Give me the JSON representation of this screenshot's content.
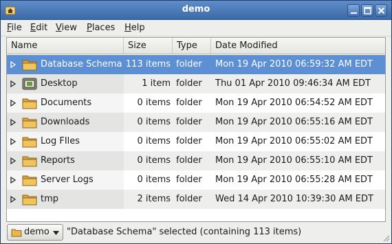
{
  "window": {
    "title": "demo",
    "icons": {
      "app": "home-folder-icon",
      "minimize": "minimize-icon",
      "maximize": "maximize-icon",
      "close": "close-icon"
    }
  },
  "menubar": {
    "items": [
      {
        "label": "File",
        "accel": "F",
        "rest": "ile"
      },
      {
        "label": "Edit",
        "accel": "E",
        "rest": "dit"
      },
      {
        "label": "View",
        "accel": "V",
        "rest": "iew"
      },
      {
        "label": "Places",
        "accel": "P",
        "rest": "laces"
      },
      {
        "label": "Help",
        "accel": "H",
        "rest": "elp"
      }
    ]
  },
  "columns": {
    "name": "Name",
    "size": "Size",
    "type": "Type",
    "date": "Date Modified"
  },
  "files": [
    {
      "name": "Database Schema",
      "size": "113 items",
      "type": "folder",
      "date": "Mon 19 Apr 2010 06:59:32 AM EDT",
      "icon": "folder-icon",
      "selected": true
    },
    {
      "name": "Desktop",
      "size": "1 item",
      "type": "folder",
      "date": "Thu 01 Apr 2010 09:46:34 AM EDT",
      "icon": "desktop-folder-icon",
      "selected": false
    },
    {
      "name": "Documents",
      "size": "0 items",
      "type": "folder",
      "date": "Mon 19 Apr 2010 06:54:52 AM EDT",
      "icon": "folder-icon",
      "selected": false
    },
    {
      "name": "Downloads",
      "size": "0 items",
      "type": "folder",
      "date": "Mon 19 Apr 2010 06:55:16 AM EDT",
      "icon": "folder-icon",
      "selected": false
    },
    {
      "name": "Log FIles",
      "size": "0 items",
      "type": "folder",
      "date": "Mon 19 Apr 2010 06:55:02 AM EDT",
      "icon": "folder-icon",
      "selected": false
    },
    {
      "name": "Reports",
      "size": "0 items",
      "type": "folder",
      "date": "Mon 19 Apr 2010 06:55:10 AM EDT",
      "icon": "folder-icon",
      "selected": false
    },
    {
      "name": "Server Logs",
      "size": "0 items",
      "type": "folder",
      "date": "Mon 19 Apr 2010 06:55:28 AM EDT",
      "icon": "folder-icon",
      "selected": false
    },
    {
      "name": "tmp",
      "size": "2 items",
      "type": "folder",
      "date": "Wed 14 Apr 2010 10:39:30 AM EDT",
      "icon": "folder-icon",
      "selected": false
    }
  ],
  "statusbar": {
    "location_label": "demo",
    "status_text": "\"Database Schema\" selected (containing 113 items)"
  },
  "colors": {
    "titlebar": "#3a6aa8",
    "selection": "#5c8fd3",
    "folder": "#e8b64a"
  }
}
